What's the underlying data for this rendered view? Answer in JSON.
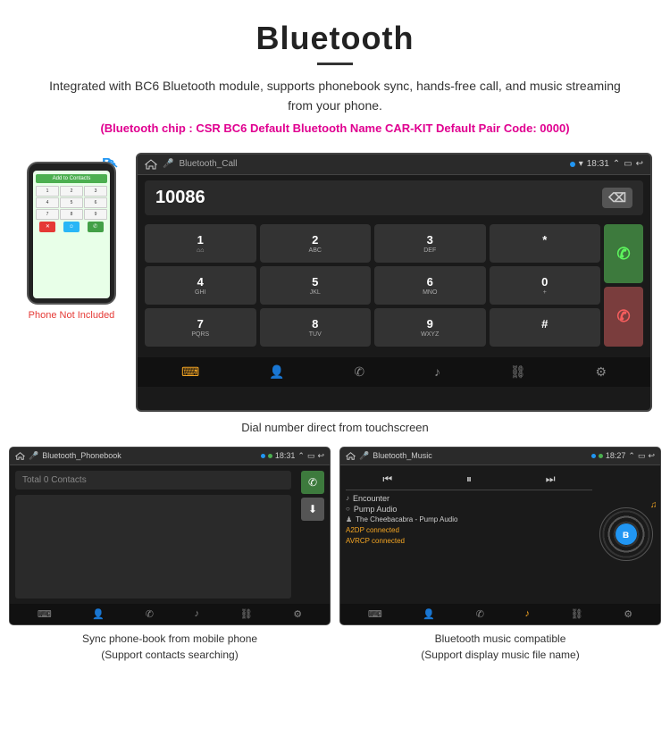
{
  "header": {
    "title": "Bluetooth",
    "description": "Integrated with BC6 Bluetooth module, supports phonebook sync, hands-free call, and music streaming from your phone.",
    "specs": "(Bluetooth chip : CSR BC6    Default Bluetooth Name CAR-KIT    Default Pair Code: 0000)"
  },
  "dial_screen": {
    "app_name": "Bluetooth_Call",
    "time": "18:31",
    "dial_number": "10086",
    "keys": [
      {
        "label": "1",
        "sub": "⌂⌂"
      },
      {
        "label": "2",
        "sub": "ABC"
      },
      {
        "label": "3",
        "sub": "DEF"
      },
      {
        "label": "*",
        "sub": ""
      },
      {
        "label": "4",
        "sub": "GHI"
      },
      {
        "label": "5",
        "sub": "JKL"
      },
      {
        "label": "6",
        "sub": "MNO"
      },
      {
        "label": "0",
        "sub": "+"
      },
      {
        "label": "7",
        "sub": "PQRS"
      },
      {
        "label": "8",
        "sub": "TUV"
      },
      {
        "label": "9",
        "sub": "WXYZ"
      },
      {
        "label": "#",
        "sub": ""
      }
    ],
    "caption": "Dial number direct from touchscreen"
  },
  "phonebook_screen": {
    "app_name": "Bluetooth_Phonebook",
    "time": "18:31",
    "search_placeholder": "Total 0 Contacts",
    "caption_line1": "Sync phone-book from mobile phone",
    "caption_line2": "(Support contacts searching)"
  },
  "music_screen": {
    "app_name": "Bluetooth_Music",
    "time": "18:27",
    "tracks": [
      {
        "icon": "♪",
        "name": "Encounter"
      },
      {
        "icon": "○",
        "name": "Pump Audio"
      },
      {
        "icon": "♟",
        "name": "The Cheebacabra - Pump Audio"
      }
    ],
    "connection_status": [
      "A2DP connected",
      "AVRCP connected"
    ],
    "caption_line1": "Bluetooth music compatible",
    "caption_line2": "(Support display music file name)"
  },
  "phone_mockup": {
    "label": "Phone Not Included"
  }
}
